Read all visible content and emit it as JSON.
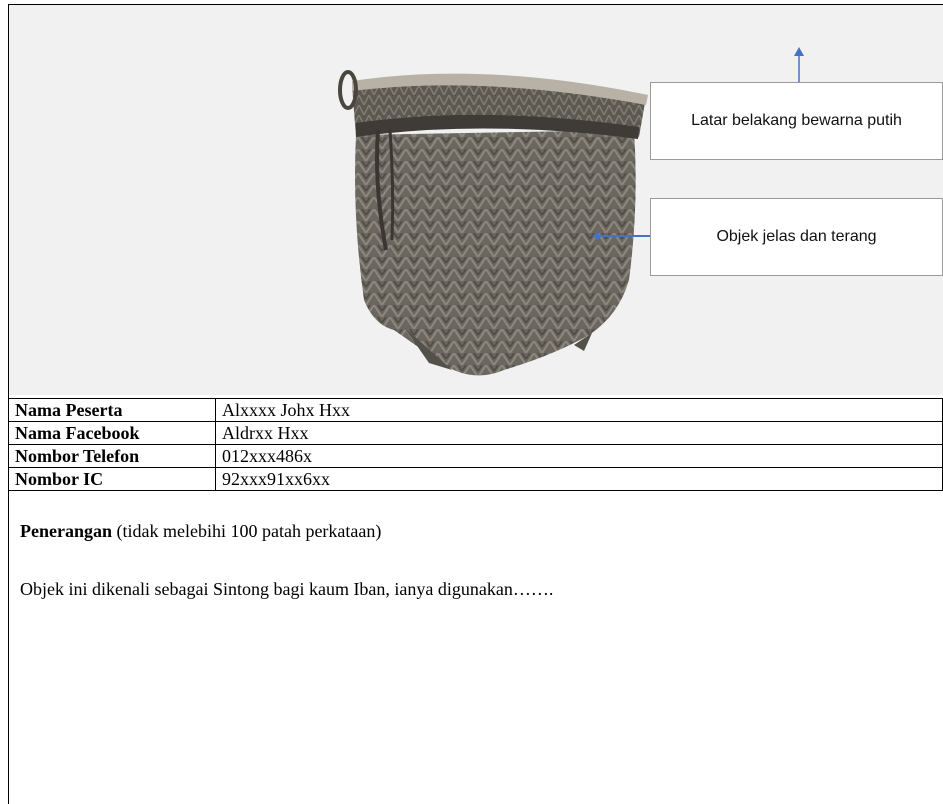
{
  "photo": {
    "callouts": [
      {
        "text": "Latar belakang bewarna putih"
      },
      {
        "text": "Objek jelas dan terang"
      }
    ]
  },
  "info": {
    "rows": [
      {
        "label": "Nama Peserta",
        "value": "Alxxxx Johx Hxx"
      },
      {
        "label": "Nama Facebook",
        "value": "Aldrxx Hxx"
      },
      {
        "label": "Nombor Telefon",
        "value": "012xxx486x"
      },
      {
        "label": "Nombor IC",
        "value": "92xxx91xx6xx"
      }
    ]
  },
  "description": {
    "heading": "Penerangan",
    "note": " (tidak melebihi 100 patah perkataan)",
    "body": "Objek ini dikenali sebagai Sintong bagi kaum Iban, ianya digunakan……."
  },
  "colors": {
    "photo_background": "#f1f1f1",
    "arrow": "#4472c4",
    "basket": "#6b6760"
  }
}
